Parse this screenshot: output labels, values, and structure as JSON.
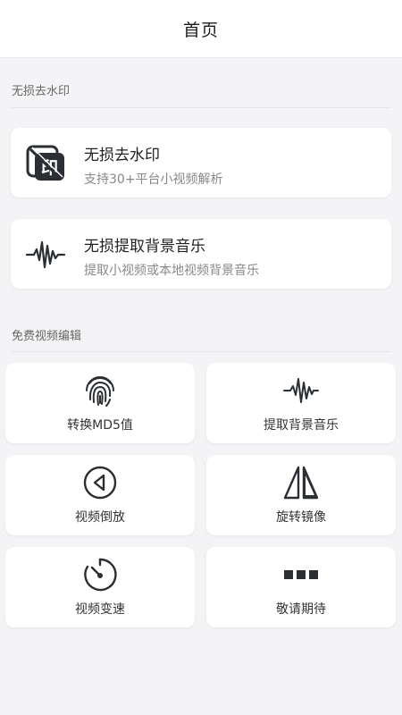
{
  "header": {
    "title": "首页"
  },
  "section1": {
    "label": "无损去水印",
    "cards": [
      {
        "title": "无损去水印",
        "subtitle": "支持30+平台小视频解析",
        "icon": "watermark-removal-icon"
      },
      {
        "title": "无损提取背景音乐",
        "subtitle": "提取小视频或本地视频背景音乐",
        "icon": "soundwave-icon"
      }
    ]
  },
  "section2": {
    "label": "免费视频编辑",
    "tiles": [
      {
        "label": "转换MD5值",
        "icon": "fingerprint-icon"
      },
      {
        "label": "提取背景音乐",
        "icon": "soundwave-icon"
      },
      {
        "label": "视频倒放",
        "icon": "rewind-play-icon"
      },
      {
        "label": "旋转镜像",
        "icon": "mirror-flip-icon"
      },
      {
        "label": "视频变速",
        "icon": "stopwatch-icon"
      },
      {
        "label": "敬请期待",
        "icon": "more-dots-icon"
      }
    ]
  },
  "colors": {
    "background": "#f4f4f6",
    "card": "#ffffff",
    "text": "#222222",
    "subtext": "#888888"
  }
}
